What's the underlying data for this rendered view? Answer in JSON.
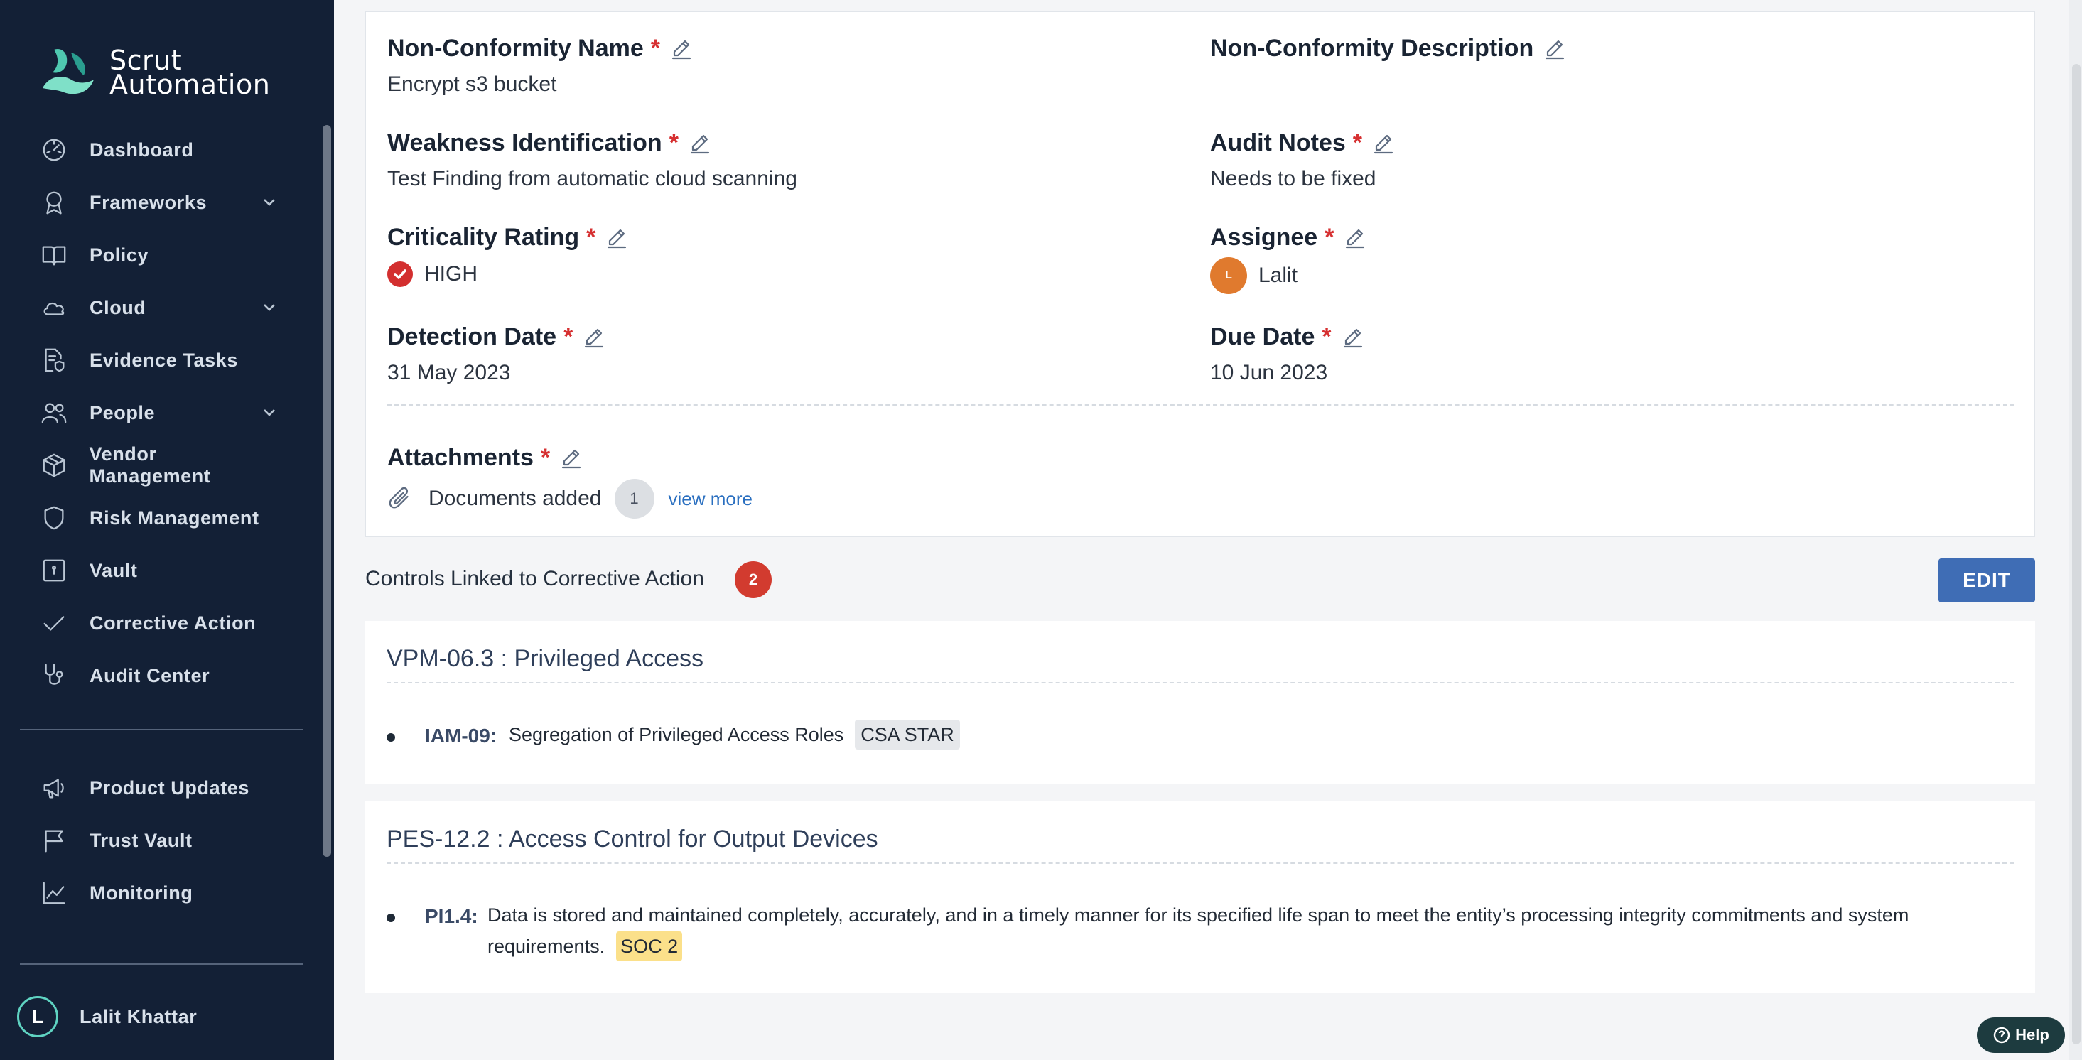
{
  "app": {
    "brand_line1": "Scrut",
    "brand_line2": "Automation"
  },
  "sidebar": {
    "items": [
      {
        "label": "Dashboard",
        "icon": "dashboard-icon"
      },
      {
        "label": "Frameworks",
        "icon": "award-icon",
        "expandable": true
      },
      {
        "label": "Policy",
        "icon": "book-icon"
      },
      {
        "label": "Cloud",
        "icon": "cloud-icon",
        "expandable": true
      },
      {
        "label": "Evidence Tasks",
        "icon": "file-shield-icon"
      },
      {
        "label": "People",
        "icon": "users-icon",
        "expandable": true
      },
      {
        "label": "Vendor Management",
        "icon": "package-icon"
      },
      {
        "label": "Risk Management",
        "icon": "shield-icon"
      },
      {
        "label": "Vault",
        "icon": "vault-icon"
      },
      {
        "label": "Corrective Action",
        "icon": "check-icon"
      },
      {
        "label": "Audit Center",
        "icon": "stethoscope-icon"
      }
    ],
    "secondary_items": [
      {
        "label": "Product Updates",
        "icon": "megaphone-icon"
      },
      {
        "label": "Trust Vault",
        "icon": "flag-icon"
      },
      {
        "label": "Monitoring",
        "icon": "chart-line-icon"
      }
    ],
    "user": {
      "initial": "L",
      "name": "Lalit Khattar"
    }
  },
  "details": {
    "nc_name": {
      "label": "Non-Conformity Name",
      "value": "Encrypt s3 bucket"
    },
    "nc_description": {
      "label": "Non-Conformity Description",
      "value": ""
    },
    "weakness": {
      "label": "Weakness Identification",
      "value": "Test Finding from automatic cloud scanning"
    },
    "audit_notes": {
      "label": "Audit Notes",
      "value": "Needs to be fixed"
    },
    "criticality": {
      "label": "Criticality Rating",
      "value": "HIGH",
      "color": "#d32f2f"
    },
    "assignee": {
      "label": "Assignee",
      "initial": "L",
      "value": "Lalit",
      "color": "#e07a2e"
    },
    "detection_date": {
      "label": "Detection Date",
      "value": "31 May 2023"
    },
    "due_date": {
      "label": "Due Date",
      "value": "10 Jun 2023"
    },
    "attachments": {
      "label": "Attachments",
      "value": "Documents added",
      "count": "1",
      "link": "view more"
    },
    "required_mark": "*"
  },
  "controls": {
    "title": "Controls Linked to Corrective Action",
    "count": "2",
    "edit_label": "EDIT",
    "items": [
      {
        "code": "VPM-06.3 :",
        "name": "Privileged Access",
        "sub_code": "IAM-09:",
        "sub_text": "Segregation of Privileged Access Roles",
        "tag": "CSA STAR"
      },
      {
        "code": "PES-12.2 :",
        "name": "Access Control for Output Devices",
        "sub_code": "PI1.4:",
        "sub_text": "Data is stored and maintained completely, accurately, and in a timely manner for its specified life span to meet the entity’s processing integrity commitments and system requirements.",
        "tag": "SOC 2"
      }
    ]
  },
  "help": {
    "label": "Help"
  },
  "colors": {
    "sidebar_bg": "#132036",
    "accent": "#3f6db5",
    "danger": "#d32f2f",
    "logo_teal": "#5fd3c2"
  }
}
